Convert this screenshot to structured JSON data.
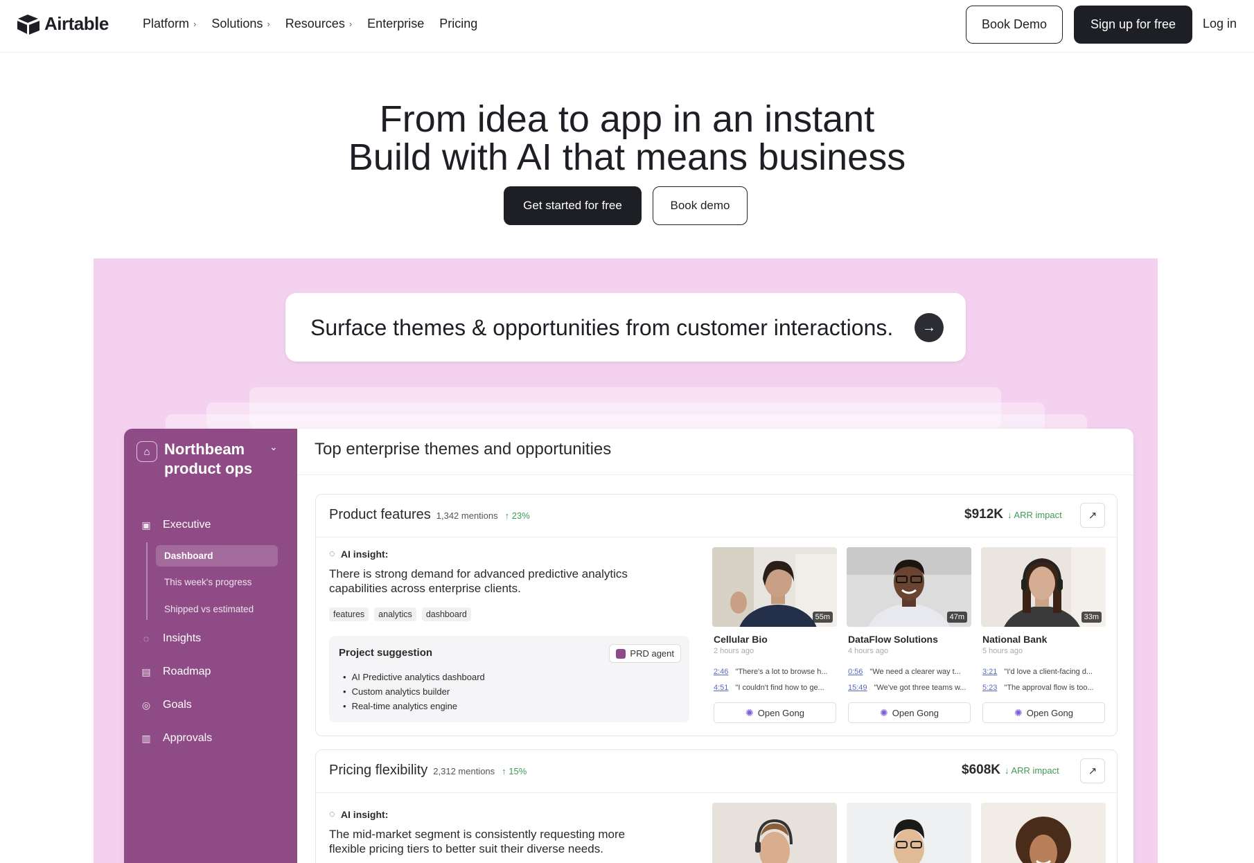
{
  "nav": {
    "brand": "Airtable",
    "links": [
      {
        "label": "Platform",
        "has_chevron": true
      },
      {
        "label": "Solutions",
        "has_chevron": true
      },
      {
        "label": "Resources",
        "has_chevron": true
      },
      {
        "label": "Enterprise",
        "has_chevron": false
      },
      {
        "label": "Pricing",
        "has_chevron": false
      }
    ],
    "book_demo": "Book Demo",
    "sign_up": "Sign up for free",
    "log_in": "Log in"
  },
  "hero": {
    "line1": "From idea to app in an instant",
    "line2": "Build with AI that means business",
    "primary_cta": "Get started for free",
    "secondary_cta": "Book demo"
  },
  "prompt": {
    "text": "Surface themes & opportunities from customer interactions.",
    "icon": "arrow-right-icon"
  },
  "app": {
    "workspace": "Northbeam product ops",
    "sidebar": {
      "executive": "Executive",
      "sub_items": [
        "Dashboard",
        "This week's progress",
        "Shipped vs estimated"
      ],
      "items": [
        "Insights",
        "Roadmap",
        "Goals",
        "Approvals"
      ]
    },
    "title": "Top enterprise themes and opportunities",
    "cards": [
      {
        "title": "Product features",
        "mentions": "1,342 mentions",
        "trend": "↑ 23%",
        "arr_value": "$912K",
        "arr_label": "↓ ARR impact",
        "insight_label": "AI insight:",
        "insight": "There is strong demand for advanced predictive analytics capabilities across enterprise clients.",
        "tags": [
          "features",
          "analytics",
          "dashboard"
        ],
        "suggestion_title": "Project suggestion",
        "suggestion_agent": "PRD agent",
        "suggestions": [
          "AI Predictive analytics dashboard",
          "Custom analytics builder",
          "Real-time analytics engine"
        ],
        "videos": [
          {
            "company": "Cellular Bio",
            "time": "2 hours ago",
            "duration": "55m",
            "quotes": [
              {
                "ts": "2:46",
                "text": "\"There's a lot to browse h..."
              },
              {
                "ts": "4:51",
                "text": "\"I couldn't find how to ge..."
              }
            ],
            "action": "Open Gong"
          },
          {
            "company": "DataFlow Solutions",
            "time": "4 hours ago",
            "duration": "47m",
            "quotes": [
              {
                "ts": "0:56",
                "text": "\"We need a clearer way t..."
              },
              {
                "ts": "15:49",
                "text": "\"We've got three teams w..."
              }
            ],
            "action": "Open Gong"
          },
          {
            "company": "National Bank",
            "time": "5 hours ago",
            "duration": "33m",
            "quotes": [
              {
                "ts": "3:21",
                "text": "\"I'd love a client-facing d..."
              },
              {
                "ts": "5:23",
                "text": "\"The approval flow is too..."
              }
            ],
            "action": "Open Gong"
          }
        ]
      },
      {
        "title": "Pricing flexibility",
        "mentions": "2,312 mentions",
        "trend": "↑ 15%",
        "arr_value": "$608K",
        "arr_label": "↓ ARR impact",
        "insight_label": "AI insight:",
        "insight": "The mid-market segment is consistently requesting more flexible pricing tiers to better suit their diverse needs."
      }
    ]
  },
  "colors": {
    "dark": "#1d1f25",
    "stage_pink": "#f4d2ef",
    "sidebar_purple": "#8f4b86",
    "trend_green": "#3f9a55"
  }
}
